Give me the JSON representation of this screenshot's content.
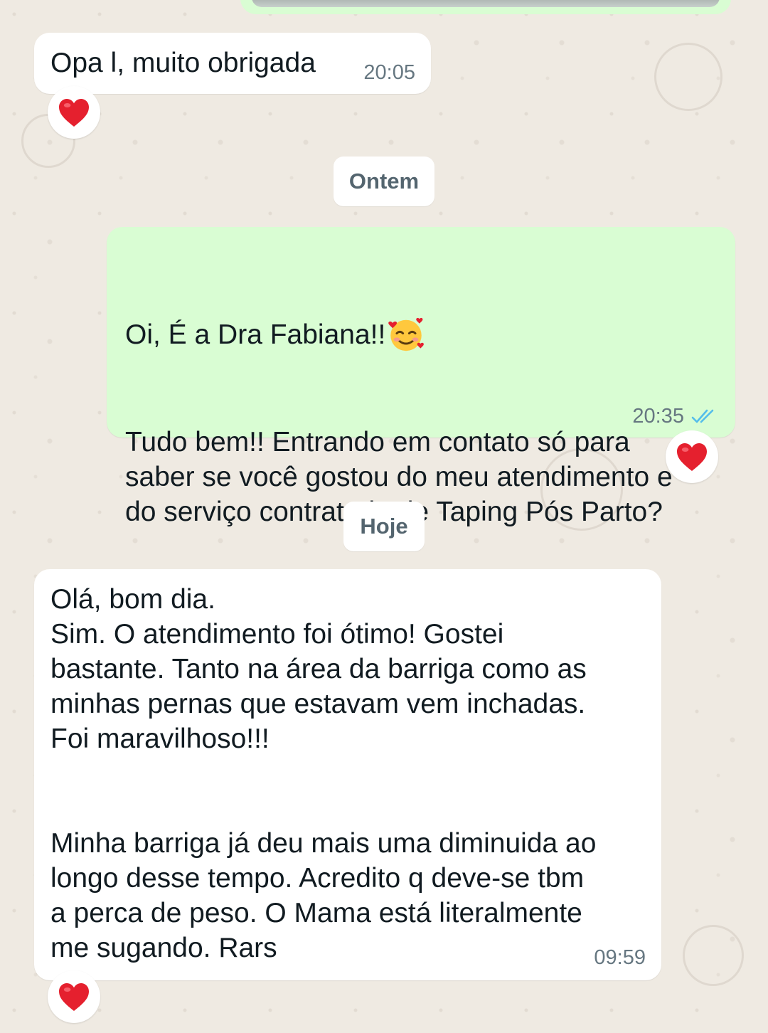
{
  "chat": {
    "messages": [
      {
        "direction": "incoming",
        "text": "Opa l, muito obrigada",
        "time": "20:05",
        "reaction": "heart"
      },
      {
        "direction": "outgoing",
        "text_line1": "Oi, É a Dra Fabiana!!",
        "text_rest": "Tudo bem!! Entrando em contato só para\nsaber se você gostou do meu atendimento e\ndo serviço contratado de Taping Pós Parto?",
        "time": "20:35",
        "status": "read",
        "reaction": "heart"
      },
      {
        "direction": "incoming",
        "text": "Olá, bom dia.\nSim. O atendimento foi ótimo! Gostei\nbastante. Tanto na área da barriga como as\nminhas pernas que estavam vem inchadas.\nFoi maravilhoso!!!\n\n\nMinha barriga já deu mais uma diminuida ao\nlongo desse tempo. Acredito q deve-se tbm\na perca de peso. O Mama está literalmente\nme sugando. Rars",
        "time": "09:59",
        "reaction": "heart"
      }
    ],
    "date_separators": [
      "Ontem",
      "Hoje"
    ]
  },
  "icons": {
    "reaction": "heart-icon",
    "emoji": "smiling-face-with-hearts-icon",
    "status": "double-check-read-icon"
  },
  "colors": {
    "background": "#efeae2",
    "incoming_bubble": "#ffffff",
    "outgoing_bubble": "#d9fdd3",
    "read_ticks": "#53bdeb",
    "heart": "#e5202e"
  }
}
